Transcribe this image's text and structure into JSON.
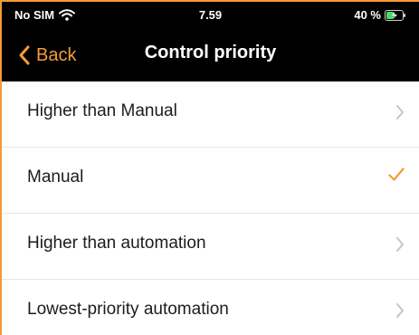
{
  "status_bar": {
    "carrier": "No SIM",
    "time": "7.59",
    "battery": "40 %",
    "icons": [
      "wifi-icon",
      "battery-charging-icon"
    ]
  },
  "nav": {
    "back_label": "Back",
    "title": "Control priority",
    "accent_color": "#f39c3b"
  },
  "options": [
    {
      "label": "Higher than Manual",
      "accessory": "chevron-right-icon",
      "selected": false
    },
    {
      "label": "Manual",
      "accessory": "checkmark-icon",
      "selected": true
    },
    {
      "label": "Higher than automation",
      "accessory": "chevron-right-icon",
      "selected": false
    },
    {
      "label": "Lowest-priority automation",
      "accessory": "chevron-right-icon",
      "selected": false
    }
  ]
}
